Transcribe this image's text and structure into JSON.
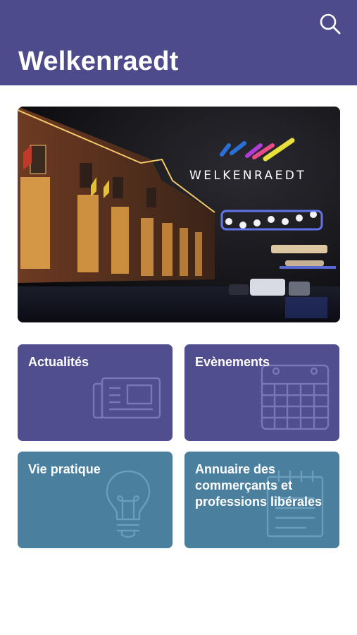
{
  "header": {
    "title": "Welkenraedt",
    "search_icon": "search-icon"
  },
  "hero": {
    "logo_text": "WELKENRAEDT",
    "logo_colors": [
      "#2a6fd6",
      "#e8e03a",
      "#e84a8a",
      "#b03bd8"
    ]
  },
  "tiles": [
    {
      "label": "Actualités",
      "icon": "newspaper-icon",
      "color": "#504e8e"
    },
    {
      "label": "Evènements",
      "icon": "calendar-icon",
      "color": "#504e8e"
    },
    {
      "label": "Vie pratique",
      "icon": "lightbulb-icon",
      "color": "#4a7f9e"
    },
    {
      "label": "Annuaire des commerçants et professions libérales",
      "icon": "notepad-icon",
      "color": "#4a7f9e"
    }
  ]
}
